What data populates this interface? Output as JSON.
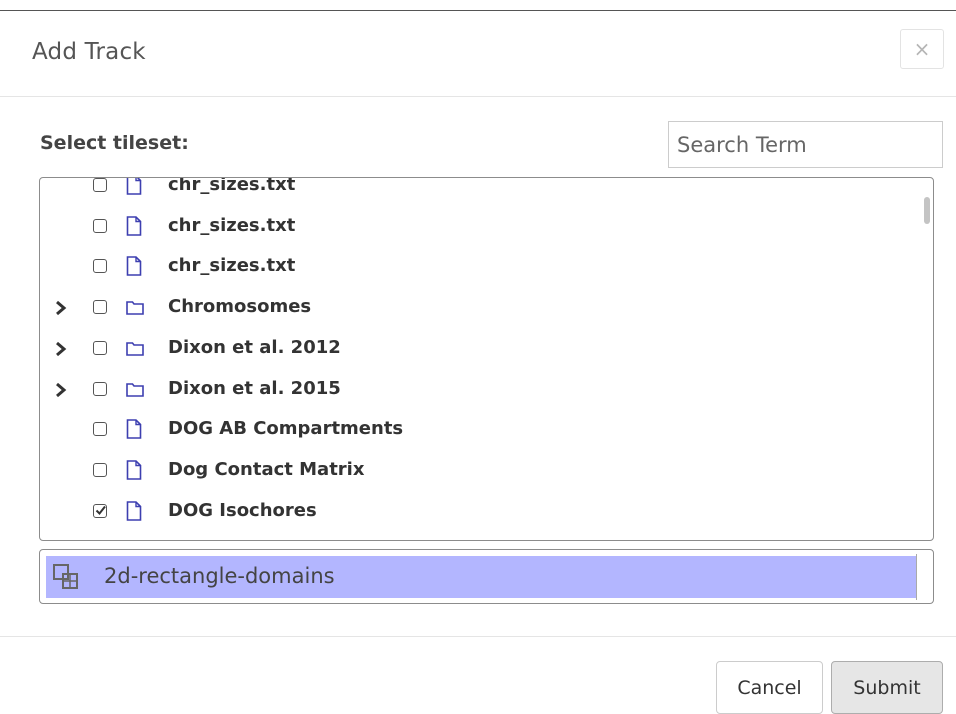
{
  "dialog": {
    "title": "Add Track",
    "close_symbol": "×"
  },
  "tileset": {
    "label": "Select tileset:",
    "search_placeholder": "Search Term"
  },
  "tree": {
    "items": [
      {
        "label": "chr_sizes.txt",
        "type": "file",
        "expandable": false,
        "checked": false
      },
      {
        "label": "chr_sizes.txt",
        "type": "file",
        "expandable": false,
        "checked": false
      },
      {
        "label": "chr_sizes.txt",
        "type": "file",
        "expandable": false,
        "checked": false
      },
      {
        "label": "Chromosomes",
        "type": "folder",
        "expandable": true,
        "checked": false
      },
      {
        "label": "Dixon et al. 2012",
        "type": "folder",
        "expandable": true,
        "checked": false
      },
      {
        "label": "Dixon et al. 2015",
        "type": "folder",
        "expandable": true,
        "checked": false
      },
      {
        "label": "DOG AB Compartments",
        "type": "file",
        "expandable": false,
        "checked": false
      },
      {
        "label": "Dog Contact Matrix",
        "type": "file",
        "expandable": false,
        "checked": false
      },
      {
        "label": "DOG Isochores",
        "type": "file",
        "expandable": false,
        "checked": true
      }
    ]
  },
  "selected_track": {
    "label": "2d-rectangle-domains",
    "icon": "2d-rectangle-domains-icon",
    "highlight_color": "#b3b6ff"
  },
  "footer": {
    "cancel_label": "Cancel",
    "submit_label": "Submit"
  },
  "colors": {
    "icon_blue": "#3d3fb0",
    "text": "#333333"
  }
}
